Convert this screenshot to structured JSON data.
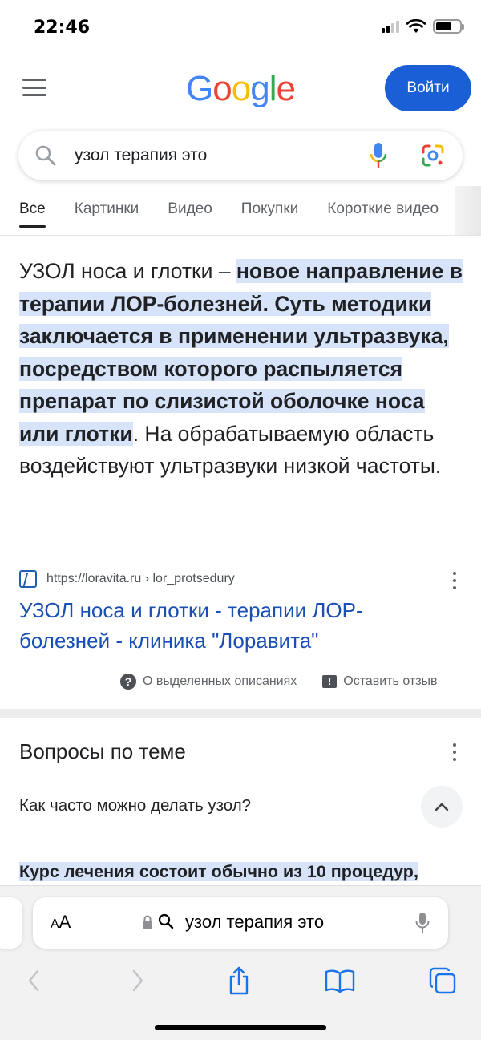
{
  "status_bar": {
    "time": "22:46"
  },
  "header": {
    "logo_letters": [
      "G",
      "o",
      "o",
      "g",
      "l",
      "e"
    ],
    "logo_colors": [
      "#4285F4",
      "#EA4335",
      "#FBBC05",
      "#4285F4",
      "#34A853",
      "#EA4335"
    ],
    "signin_label": "Войти"
  },
  "search": {
    "query": "узол терапия это"
  },
  "tabs": [
    {
      "label": "Все",
      "active": true
    },
    {
      "label": "Картинки",
      "active": false
    },
    {
      "label": "Видео",
      "active": false
    },
    {
      "label": "Покупки",
      "active": false
    },
    {
      "label": "Короткие видео",
      "active": false
    }
  ],
  "featured_snippet": {
    "lead": "УЗОЛ носа и глотки – ",
    "highlighted": "новое направление в терапии ЛОР-болезней. Суть методики заключается в применении ультразвука, посредством которого распыляется препарат по слизистой оболочке носа или глотки",
    "rest": ". На обрабатываемую область воздействуют ультразвуки низкой частоты.",
    "source_url": "https://loravita.ru › lor_protsedury",
    "result_title": "УЗОЛ носа и глотки - терапии ЛОР-болезней - клиника \"Лоравита\"",
    "about_label": "О выделенных описаниях",
    "feedback_label": "Оставить отзыв"
  },
  "people_also_ask": {
    "title": "Вопросы по теме",
    "question": "Как часто можно делать узол?",
    "answer_preview": "Курс лечения состоит обычно из 10 процедур,"
  },
  "safari": {
    "aa_label_small": "A",
    "aa_label_large": "A",
    "address_text": "узол терапия это"
  },
  "colors": {
    "accent_blue": "#1a5fd6",
    "link_blue": "#1a4fb3",
    "highlight": "#d6e3f8"
  }
}
